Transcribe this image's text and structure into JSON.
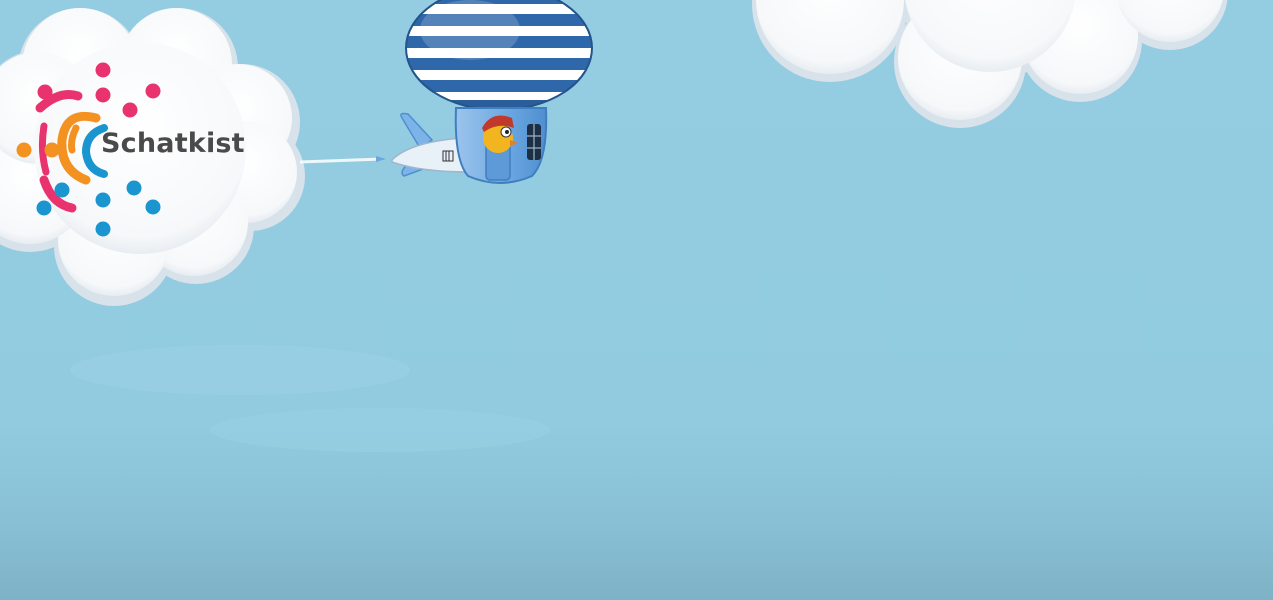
{
  "brand": {
    "name": "Schatkist",
    "logo_colors": {
      "pink": "#e8336f",
      "orange": "#f39221",
      "blue": "#1a95cf"
    }
  },
  "scene": {
    "sky_color": "#94cde2",
    "cloud_color": "#ffffff",
    "balloon_stripes": [
      "#2f68aa",
      "#ffffff"
    ],
    "gondola_color": "#6aa6e0"
  }
}
